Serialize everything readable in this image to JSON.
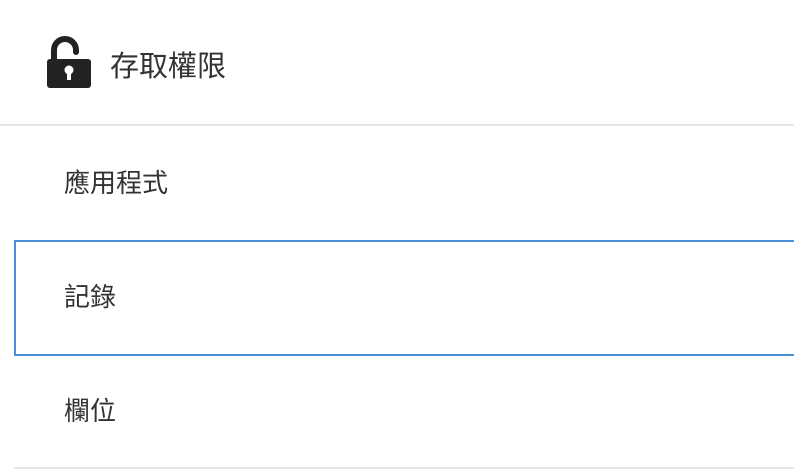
{
  "header": {
    "icon": "unlock-icon",
    "title": "存取權限"
  },
  "nav": {
    "items": [
      {
        "label": "應用程式",
        "selected": false
      },
      {
        "label": "記錄",
        "selected": true
      },
      {
        "label": "欄位",
        "selected": false
      }
    ]
  },
  "colors": {
    "selected_border": "#4a90d9",
    "divider": "#e6e6e6",
    "text": "#333333",
    "icon": "#222222"
  }
}
